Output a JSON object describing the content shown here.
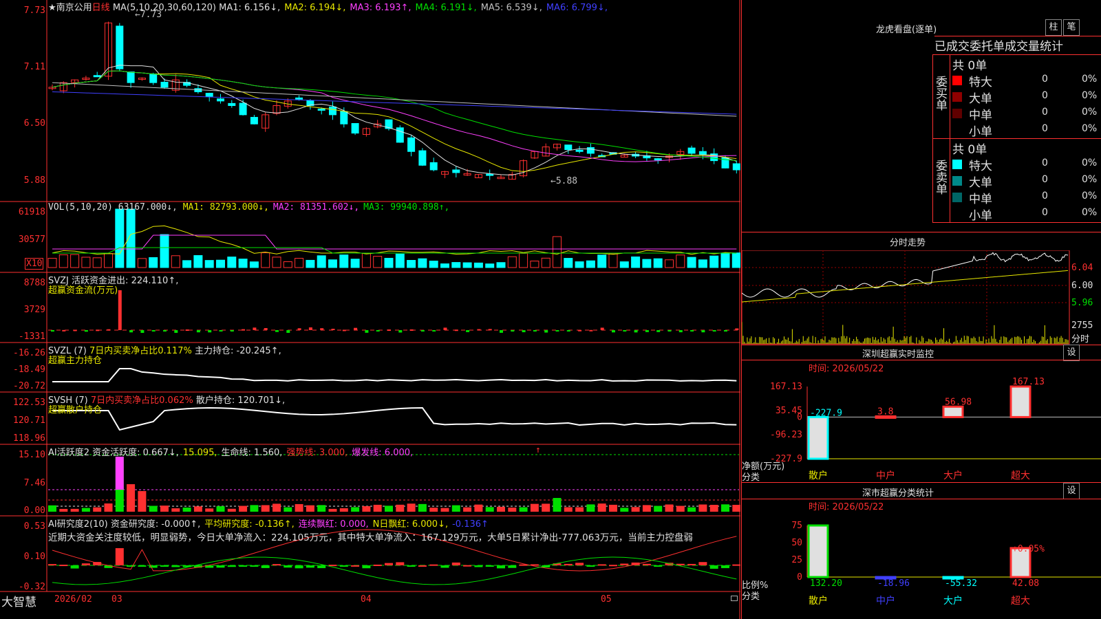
{
  "stock": {
    "name": "★南京公用",
    "period": "日线"
  },
  "main_panel": {
    "ma_label": "MA(5,10,20,30,60,120)",
    "ma_items": [
      {
        "label": "MA1:",
        "value": "6.156",
        "arrow": "↓",
        "color": "#e0e0e0"
      },
      {
        "label": "MA2:",
        "value": "6.194",
        "arrow": "↓",
        "color": "#e8e800"
      },
      {
        "label": "MA3:",
        "value": "6.193",
        "arrow": "↑",
        "color": "#ff40ff"
      },
      {
        "label": "MA4:",
        "value": "6.191",
        "arrow": "↓",
        "color": "#00e000"
      },
      {
        "label": "MA5:",
        "value": "6.539",
        "arrow": "↓",
        "color": "#c0c0c0"
      },
      {
        "label": "MA6:",
        "value": "6.799",
        "arrow": "↓",
        "color": "#4040ff"
      }
    ],
    "axis": [
      "7.73",
      "7.11",
      "6.50",
      "5.88"
    ],
    "high_label": "←7.73",
    "low_label": "←5.88"
  },
  "vol_panel": {
    "title": "VOL(5,10,20)",
    "value": "63167.000↓",
    "items": [
      {
        "label": "MA1:",
        "value": "82793.000↓",
        "color": "#e8e800"
      },
      {
        "label": "MA2:",
        "value": "81351.602↓",
        "color": "#ff40ff"
      },
      {
        "label": "MA3:",
        "value": "99940.898↑",
        "color": "#00e000"
      }
    ],
    "axis": [
      "61918",
      "30577"
    ],
    "unit": "X10"
  },
  "svzj_panel": {
    "title": "SVZJ",
    "label": "活跃资金进出:",
    "value": "224.110↑,",
    "subtitle": "超赢资金流(万元)",
    "axis": [
      "8788",
      "3729",
      "-1331"
    ]
  },
  "svzl_panel": {
    "title": "SVZL (7)",
    "ratio_text": "7日内买卖净占比0.117%",
    "label": "主力持仓:",
    "value": "-20.245↑,",
    "subtitle": "超赢主力持仓",
    "axis": [
      "-16.26",
      "-18.49",
      "-20.72"
    ]
  },
  "svsh_panel": {
    "title": "SVSH (7)",
    "ratio_text": "7日内买卖净占比0.062%",
    "label": "散户持仓:",
    "value": "120.701↓,",
    "subtitle": "超赢散户持仓",
    "axis": [
      "122.53",
      "120.71",
      "118.96"
    ]
  },
  "ai_panel": {
    "title": "AI活跃度2",
    "items": [
      {
        "text": "资金活跃度: 0.667↓,",
        "color": "#e0e0e0"
      },
      {
        "text": "15.095,",
        "color": "#e8e800"
      },
      {
        "text": "生命线: 1.560,",
        "color": "#e0e0e0"
      },
      {
        "text": "强势线: 3.000,",
        "color": "#ff3030"
      },
      {
        "text": "爆发线: 6.000,",
        "color": "#ff40ff"
      }
    ],
    "arrow": "↑",
    "axis": [
      "15.10",
      "7.46",
      "0.00"
    ]
  },
  "research_panel": {
    "title": "AI研究度2(10)",
    "items": [
      {
        "text": "资金研究度: -0.000↑,",
        "color": "#e0e0e0"
      },
      {
        "text": "平均研究度: -0.136↑,",
        "color": "#e8e800"
      },
      {
        "text": "连续飘红: 0.000,",
        "color": "#ff40ff"
      },
      {
        "text": "N日飘红: 6.000↓,",
        "color": "#e8e800"
      },
      {
        "text": "-0.136↑",
        "color": "#4040ff"
      }
    ],
    "comment": "近期大资金关注度较低，明显弱势，今日大单净流入：224.105万元，其中特大单净流入：167.129万元，大单5日累计净出-777.063万元，当前主力控盘弱",
    "axis": [
      "0.53",
      "0.10",
      "-0.32"
    ]
  },
  "date_axis": {
    "brand": "大智慧",
    "labels": [
      "2026/02",
      "03",
      "04",
      "05"
    ]
  },
  "dragon_tiger": {
    "title": "龙虎看盘(逐单)",
    "btn_bar": "柱",
    "btn_pen": "笔",
    "tabs": [
      "已成交",
      "委托单",
      "成交量",
      "统计"
    ],
    "buy": {
      "title": "委买单",
      "total": "共 0单",
      "rows": [
        {
          "label": "特大",
          "count": "0",
          "pct": "0%",
          "color": "#ff0000"
        },
        {
          "label": "大单",
          "count": "0",
          "pct": "0%",
          "color": "#900000"
        },
        {
          "label": "中单",
          "count": "0",
          "pct": "0%",
          "color": "#600000"
        },
        {
          "label": "小单",
          "count": "0",
          "pct": "0%",
          "color": ""
        }
      ]
    },
    "sell": {
      "title": "委卖单",
      "total": "共 0单",
      "rows": [
        {
          "label": "特大",
          "count": "0",
          "pct": "0%",
          "color": "#00ffff"
        },
        {
          "label": "大单",
          "count": "0",
          "pct": "0%",
          "color": "#008888"
        },
        {
          "label": "中单",
          "count": "0",
          "pct": "0%",
          "color": "#006666"
        },
        {
          "label": "小单",
          "count": "0",
          "pct": "0%",
          "color": ""
        }
      ]
    }
  },
  "intraday": {
    "title": "分时走势",
    "axis": [
      "6.04",
      "6.00",
      "5.96"
    ],
    "vol_value": "2755",
    "vol_label": "分时"
  },
  "realtime_monitor": {
    "title": "深圳超赢实时监控",
    "settings": "设",
    "time": "时间: 2026/05/22",
    "axis": [
      "167.13",
      "35.45",
      "0",
      "-96.23",
      "-227.9"
    ],
    "y_caption": "净额(万元)",
    "x_caption": "分类",
    "chart_data": {
      "type": "bar",
      "categories": [
        "散户",
        "中户",
        "大户",
        "超大"
      ],
      "values": [
        -227.9,
        3.8,
        56.98,
        167.13
      ],
      "value_labels": [
        "-227.9",
        "3.8",
        "56.98",
        "167.13"
      ],
      "ylim": [
        -227.9,
        167.13
      ]
    }
  },
  "category_stats": {
    "title": "深市超赢分类统计",
    "settings": "设",
    "time": "时间: 2026/05/22",
    "axis": [
      "75",
      "50",
      "25",
      "0"
    ],
    "y_caption": "比例%",
    "x_caption": "分类",
    "top_label": "+0.05%",
    "chart_data": {
      "type": "bar",
      "categories": [
        "散户",
        "中户",
        "大户",
        "超大"
      ],
      "values": [
        132.2,
        -18.96,
        -55.32,
        42.08
      ],
      "value_labels": [
        "132.20",
        "-18.96",
        "-55.32",
        "42.08"
      ],
      "ylim": [
        0,
        75
      ]
    }
  }
}
